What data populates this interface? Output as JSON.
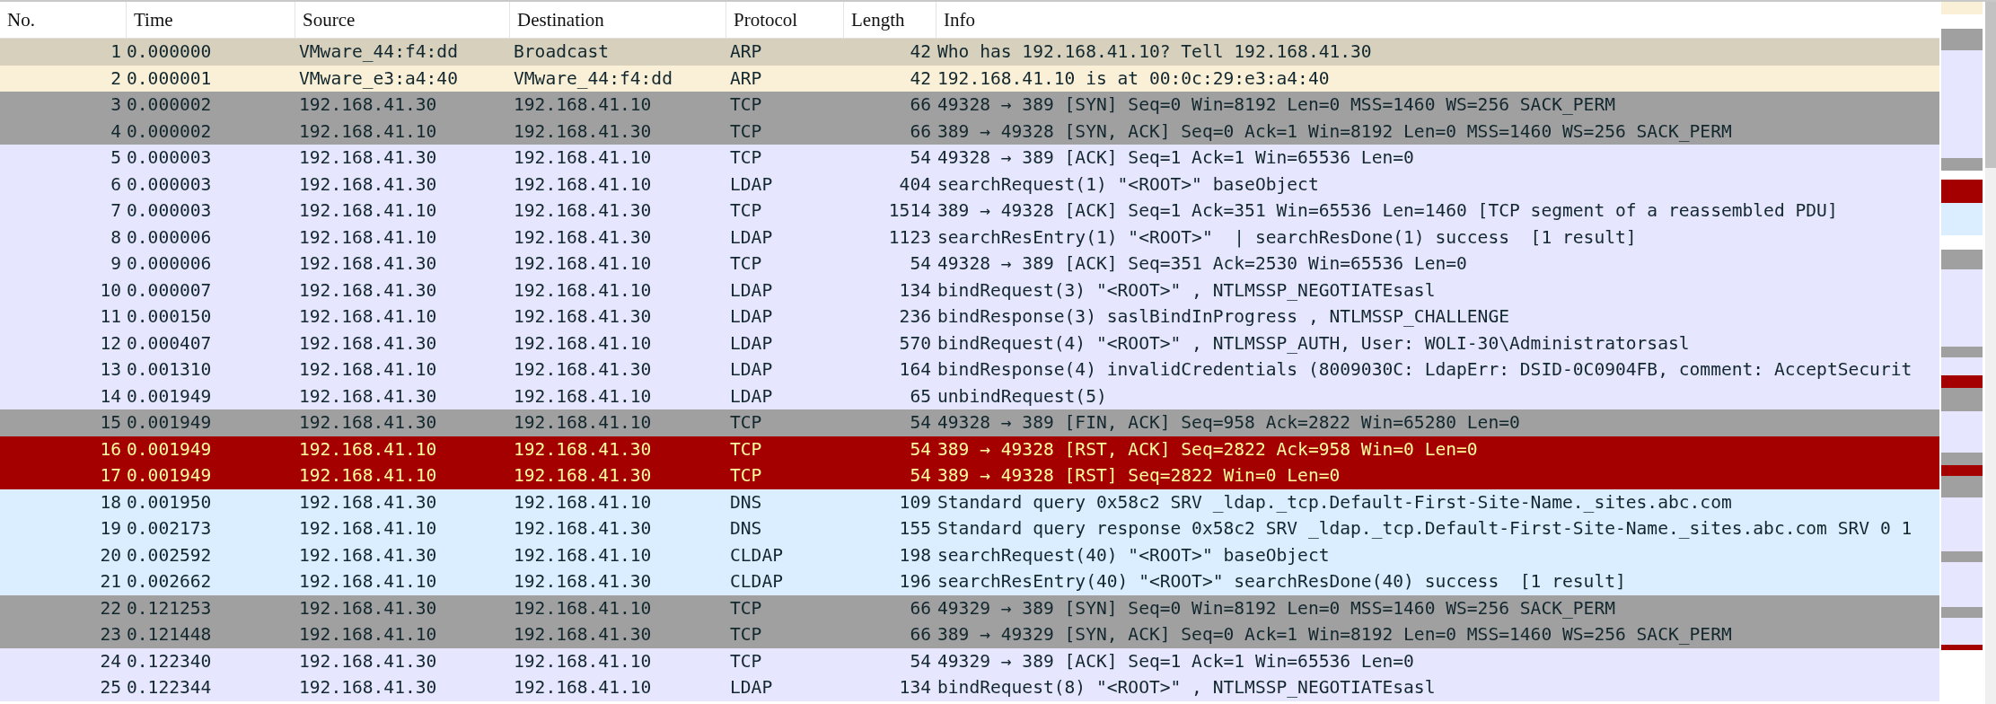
{
  "packet_list": {
    "columns": [
      "No.",
      "Time",
      "Source",
      "Destination",
      "Protocol",
      "Length",
      "Info"
    ],
    "rows": [
      {
        "cells": [
          "1",
          "0.000000",
          "VMware_44:f4:dd",
          "Broadcast",
          "ARP",
          "42",
          "Who has 192.168.41.10? Tell 192.168.41.30"
        ],
        "color": "#d6d0bc",
        "kind": "normal"
      },
      {
        "cells": [
          "2",
          "0.000001",
          "VMware_e3:a4:40",
          "VMware_44:f4:dd",
          "ARP",
          "42",
          "192.168.41.10 is at 00:0c:29:e3:a4:40"
        ],
        "color": "#faf0d7",
        "kind": "normal"
      },
      {
        "cells": [
          "3",
          "0.000002",
          "192.168.41.30",
          "192.168.41.10",
          "TCP",
          "66",
          "49328 → 389 [SYN] Seq=0 Win=8192 Len=0 MSS=1460 WS=256 SACK_PERM"
        ],
        "color": "#a0a0a0",
        "kind": "normal"
      },
      {
        "cells": [
          "4",
          "0.000002",
          "192.168.41.10",
          "192.168.41.30",
          "TCP",
          "66",
          "389 → 49328 [SYN, ACK] Seq=0 Ack=1 Win=8192 Len=0 MSS=1460 WS=256 SACK_PERM"
        ],
        "color": "#a0a0a0",
        "kind": "normal"
      },
      {
        "cells": [
          "5",
          "0.000003",
          "192.168.41.30",
          "192.168.41.10",
          "TCP",
          "54",
          "49328 → 389 [ACK] Seq=1 Ack=1 Win=65536 Len=0"
        ],
        "color": "#e7e6ff",
        "kind": "normal"
      },
      {
        "cells": [
          "6",
          "0.000003",
          "192.168.41.30",
          "192.168.41.10",
          "LDAP",
          "404",
          "searchRequest(1) \"<ROOT>\" baseObject"
        ],
        "color": "#e7e6ff",
        "kind": "normal"
      },
      {
        "cells": [
          "7",
          "0.000003",
          "192.168.41.10",
          "192.168.41.30",
          "TCP",
          "1514",
          "389 → 49328 [ACK] Seq=1 Ack=351 Win=65536 Len=1460 [TCP segment of a reassembled PDU]"
        ],
        "color": "#e7e6ff",
        "kind": "normal"
      },
      {
        "cells": [
          "8",
          "0.000006",
          "192.168.41.10",
          "192.168.41.30",
          "LDAP",
          "1123",
          "searchResEntry(1) \"<ROOT>\"  | searchResDone(1) success  [1 result]"
        ],
        "color": "#e7e6ff",
        "kind": "normal"
      },
      {
        "cells": [
          "9",
          "0.000006",
          "192.168.41.30",
          "192.168.41.10",
          "TCP",
          "54",
          "49328 → 389 [ACK] Seq=351 Ack=2530 Win=65536 Len=0"
        ],
        "color": "#e7e6ff",
        "kind": "normal"
      },
      {
        "cells": [
          "10",
          "0.000007",
          "192.168.41.30",
          "192.168.41.10",
          "LDAP",
          "134",
          "bindRequest(3) \"<ROOT>\" , NTLMSSP_NEGOTIATEsasl"
        ],
        "color": "#e7e6ff",
        "kind": "normal"
      },
      {
        "cells": [
          "11",
          "0.000150",
          "192.168.41.10",
          "192.168.41.30",
          "LDAP",
          "236",
          "bindResponse(3) saslBindInProgress , NTLMSSP_CHALLENGE"
        ],
        "color": "#e7e6ff",
        "kind": "normal"
      },
      {
        "cells": [
          "12",
          "0.000407",
          "192.168.41.30",
          "192.168.41.10",
          "LDAP",
          "570",
          "bindRequest(4) \"<ROOT>\" , NTLMSSP_AUTH, User: WOLI-30\\Administratorsasl"
        ],
        "color": "#e7e6ff",
        "kind": "normal"
      },
      {
        "cells": [
          "13",
          "0.001310",
          "192.168.41.10",
          "192.168.41.30",
          "LDAP",
          "164",
          "bindResponse(4) invalidCredentials (8009030C: LdapErr: DSID-0C0904FB, comment: AcceptSecurit"
        ],
        "color": "#e7e6ff",
        "kind": "normal"
      },
      {
        "cells": [
          "14",
          "0.001949",
          "192.168.41.30",
          "192.168.41.10",
          "LDAP",
          "65",
          "unbindRequest(5)"
        ],
        "color": "#e7e6ff",
        "kind": "normal"
      },
      {
        "cells": [
          "15",
          "0.001949",
          "192.168.41.30",
          "192.168.41.10",
          "TCP",
          "54",
          "49328 → 389 [FIN, ACK] Seq=958 Ack=2822 Win=65280 Len=0"
        ],
        "color": "#a0a0a0",
        "kind": "normal"
      },
      {
        "cells": [
          "16",
          "0.001949",
          "192.168.41.10",
          "192.168.41.30",
          "TCP",
          "54",
          "389 → 49328 [RST, ACK] Seq=2822 Ack=958 Win=0 Len=0"
        ],
        "color": "#a40000",
        "kind": "error"
      },
      {
        "cells": [
          "17",
          "0.001949",
          "192.168.41.10",
          "192.168.41.30",
          "TCP",
          "54",
          "389 → 49328 [RST] Seq=2822 Win=0 Len=0"
        ],
        "color": "#a40000",
        "kind": "error"
      },
      {
        "cells": [
          "18",
          "0.001950",
          "192.168.41.30",
          "192.168.41.10",
          "DNS",
          "109",
          "Standard query 0x58c2 SRV _ldap._tcp.Default-First-Site-Name._sites.abc.com"
        ],
        "color": "#daeeff",
        "kind": "normal"
      },
      {
        "cells": [
          "19",
          "0.002173",
          "192.168.41.10",
          "192.168.41.30",
          "DNS",
          "155",
          "Standard query response 0x58c2 SRV _ldap._tcp.Default-First-Site-Name._sites.abc.com SRV 0 1"
        ],
        "color": "#daeeff",
        "kind": "normal"
      },
      {
        "cells": [
          "20",
          "0.002592",
          "192.168.41.30",
          "192.168.41.10",
          "CLDAP",
          "198",
          "searchRequest(40) \"<ROOT>\" baseObject"
        ],
        "color": "#daeeff",
        "kind": "normal"
      },
      {
        "cells": [
          "21",
          "0.002662",
          "192.168.41.10",
          "192.168.41.30",
          "CLDAP",
          "196",
          "searchResEntry(40) \"<ROOT>\" searchResDone(40) success  [1 result]"
        ],
        "color": "#daeeff",
        "kind": "normal"
      },
      {
        "cells": [
          "22",
          "0.121253",
          "192.168.41.30",
          "192.168.41.10",
          "TCP",
          "66",
          "49329 → 389 [SYN] Seq=0 Win=8192 Len=0 MSS=1460 WS=256 SACK_PERM"
        ],
        "color": "#a0a0a0",
        "kind": "normal"
      },
      {
        "cells": [
          "23",
          "0.121448",
          "192.168.41.10",
          "192.168.41.30",
          "TCP",
          "66",
          "389 → 49329 [SYN, ACK] Seq=0 Ack=1 Win=8192 Len=0 MSS=1460 WS=256 SACK_PERM"
        ],
        "color": "#a0a0a0",
        "kind": "normal"
      },
      {
        "cells": [
          "24",
          "0.122340",
          "192.168.41.30",
          "192.168.41.10",
          "TCP",
          "54",
          "49329 → 389 [ACK] Seq=1 Ack=1 Win=65536 Len=0"
        ],
        "color": "#e7e6ff",
        "kind": "normal"
      },
      {
        "cells": [
          "25",
          "0.122344",
          "192.168.41.30",
          "192.168.41.10",
          "LDAP",
          "134",
          "bindRequest(8) \"<ROOT>\" , NTLMSSP_NEGOTIATEsasl"
        ],
        "color": "#e7e6ff",
        "kind": "normal"
      }
    ]
  }
}
